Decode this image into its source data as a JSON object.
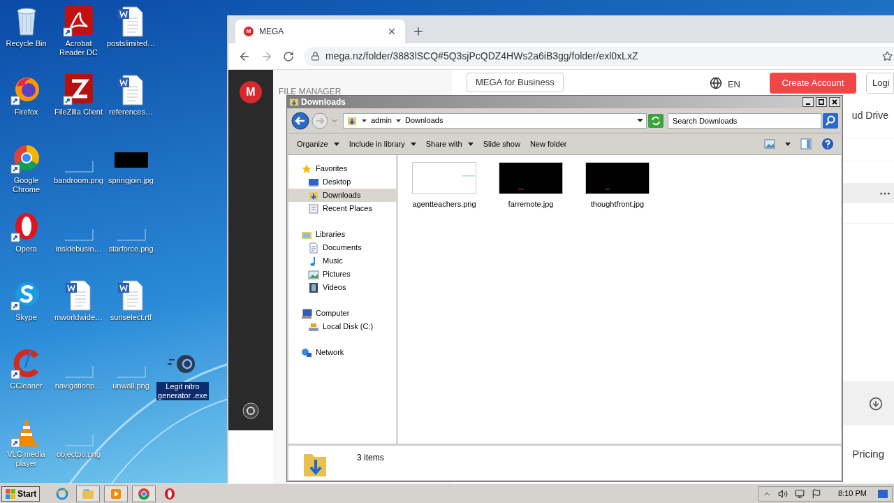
{
  "desktop_icons": [
    {
      "label": "Recycle Bin",
      "kind": "recycle",
      "shortcut": false
    },
    {
      "label": "Firefox",
      "kind": "firefox",
      "shortcut": true
    },
    {
      "label": "Google Chrome",
      "kind": "chrome",
      "shortcut": true
    },
    {
      "label": "Opera",
      "kind": "opera",
      "shortcut": true
    },
    {
      "label": "Skype",
      "kind": "skype",
      "shortcut": true
    },
    {
      "label": "CCleaner",
      "kind": "ccleaner",
      "shortcut": true
    },
    {
      "label": "VLC media player",
      "kind": "vlc",
      "shortcut": true
    },
    {
      "label": "Acrobat Reader DC",
      "kind": "acrobat",
      "shortcut": true
    },
    {
      "label": "FileZilla Client",
      "kind": "filezilla",
      "shortcut": true
    },
    {
      "label": "bandroom.png",
      "kind": "blank",
      "shortcut": false
    },
    {
      "label": "insidebusin…",
      "kind": "blank",
      "shortcut": false
    },
    {
      "label": "mworldwide…",
      "kind": "word",
      "shortcut": false
    },
    {
      "label": "navigationp…",
      "kind": "blank",
      "shortcut": false
    },
    {
      "label": "objectpo.png",
      "kind": "blank",
      "shortcut": false
    },
    {
      "label": "postslimited…",
      "kind": "word",
      "shortcut": false
    },
    {
      "label": "references…",
      "kind": "word",
      "shortcut": false
    },
    {
      "label": "springjoin.jpg",
      "kind": "black",
      "shortcut": false
    },
    {
      "label": "starforce.png",
      "kind": "blank",
      "shortcut": false
    },
    {
      "label": "sunselect.rtf",
      "kind": "word",
      "shortcut": false
    },
    {
      "label": "unwall.png",
      "kind": "blank",
      "shortcut": false
    }
  ],
  "dragged_icon": {
    "label": "Legit nitro generator .exe",
    "kind": "nitro",
    "selected": true
  },
  "browser": {
    "tab": {
      "icon_text": "M",
      "title": "MEGA"
    },
    "url": "mega.nz/folder/3883lSCQ#5Q3sjPcQDZ4HWs2a6iB3gg/folder/exl0xLxZ"
  },
  "mega": {
    "logo": "M",
    "section": "FILE MANAGER",
    "business_button": "MEGA for Business",
    "language": "EN",
    "create_account": "Create Account",
    "login": "Logi",
    "cloud_drive": "ud Drive",
    "pricing": "Pricing"
  },
  "explorer": {
    "title": "Downloads",
    "breadcrumb": [
      "admin",
      "Downloads"
    ],
    "search": {
      "placeholder": "Search Downloads"
    },
    "toolbar": [
      {
        "label": "Organize",
        "dropdown": true
      },
      {
        "label": "Include in library",
        "dropdown": true
      },
      {
        "label": "Share with",
        "dropdown": true
      },
      {
        "label": "Slide show",
        "dropdown": false
      },
      {
        "label": "New folder",
        "dropdown": false
      }
    ],
    "nav_pane": [
      {
        "label": "Favorites",
        "kind": "star",
        "selected": false,
        "children": [
          {
            "label": "Desktop",
            "kind": "desktop",
            "selected": false
          },
          {
            "label": "Downloads",
            "kind": "downloads",
            "selected": true
          },
          {
            "label": "Recent Places",
            "kind": "recent",
            "selected": false
          }
        ]
      },
      {
        "label": "Libraries",
        "kind": "libraries",
        "selected": false,
        "children": [
          {
            "label": "Documents",
            "kind": "documents",
            "selected": false
          },
          {
            "label": "Music",
            "kind": "music",
            "selected": false
          },
          {
            "label": "Pictures",
            "kind": "pictures",
            "selected": false
          },
          {
            "label": "Videos",
            "kind": "videos",
            "selected": false
          }
        ]
      },
      {
        "label": "Computer",
        "kind": "computer",
        "selected": false,
        "children": [
          {
            "label": "Local Disk (C:)",
            "kind": "disk",
            "selected": false
          }
        ]
      },
      {
        "label": "Network",
        "kind": "network",
        "selected": false
      }
    ],
    "files": [
      {
        "name": "agentteachers.png",
        "kind": "white"
      },
      {
        "name": "farremote.jpg",
        "kind": "black"
      },
      {
        "name": "thoughtfront.jpg",
        "kind": "black"
      }
    ],
    "item_count": "3 items"
  },
  "taskbar": {
    "start": "Start",
    "apps": [
      {
        "kind": "ie",
        "running": false
      },
      {
        "kind": "explorer",
        "running": true
      },
      {
        "kind": "media",
        "running": true
      },
      {
        "kind": "chrome",
        "running": true
      },
      {
        "kind": "opera",
        "running": false
      }
    ],
    "time": "8:10 PM"
  }
}
